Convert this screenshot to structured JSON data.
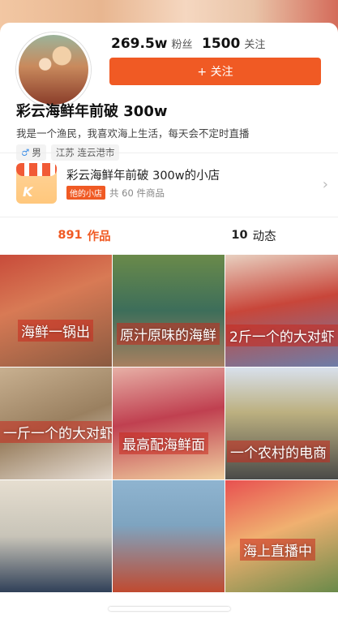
{
  "profile": {
    "fans_count": "269.5w",
    "fans_label": "粉丝",
    "following_count": "1500",
    "following_label": "关注",
    "follow_button": "+ 关注",
    "name": "彩云海鲜年前破 300w",
    "bio": "我是一个渔民，我喜欢海上生活，每天会不定时直播",
    "gender_tag": "男",
    "location_tag": "江苏 连云港市"
  },
  "shop": {
    "title": "彩云海鲜年前破 300w的小店",
    "badge": "他的小店",
    "count": "共 60 件商品",
    "icon_letter": "K"
  },
  "tabs": {
    "works_count": "891",
    "works_label": "作品",
    "posts_count": "10",
    "posts_label": "动态"
  },
  "videos": [
    {
      "caption": "海鲜一锅出"
    },
    {
      "caption": "原汁原味的海鲜"
    },
    {
      "caption": "2斤一个的大对虾"
    },
    {
      "caption": "一斤一个的大对虾"
    },
    {
      "caption": "最高配海鲜面"
    },
    {
      "caption": "一个农村的电商"
    },
    {
      "caption": ""
    },
    {
      "caption": ""
    },
    {
      "caption": "海上直播中"
    }
  ],
  "colors": {
    "accent": "#f05a24",
    "male": "#3b8ee8"
  }
}
